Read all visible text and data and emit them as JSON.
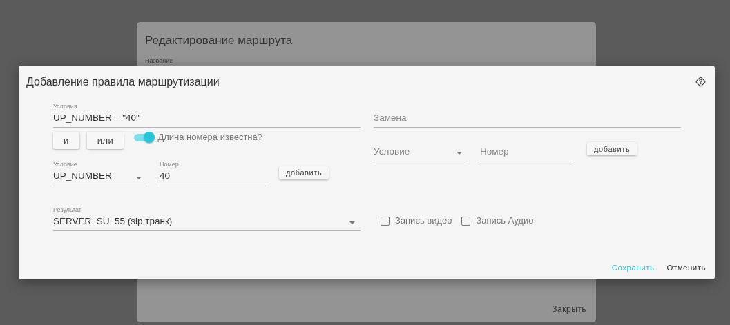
{
  "background_dialog": {
    "title": "Редактирование маршрута",
    "name_label": "Название",
    "close_button": "Закрыть"
  },
  "dialog": {
    "title": "Добавление правила маршрутизации",
    "conditions": {
      "label": "Условия",
      "value": "UP_NUMBER = \"40\""
    },
    "logic_buttons": [
      "и",
      "или"
    ],
    "length_known": {
      "label": "Длина номера известна?",
      "on": true
    },
    "condition_row": {
      "condition": {
        "label": "Условие",
        "value": "UP_NUMBER"
      },
      "number": {
        "label": "Номер",
        "value": "40"
      },
      "add_button": "добавить"
    },
    "replacement": {
      "placeholder": "Замена"
    },
    "replacement_row": {
      "condition": {
        "placeholder": "Условие"
      },
      "number": {
        "placeholder": "Номер"
      },
      "add_button": "добавить"
    },
    "result": {
      "label": "Результат",
      "value": "SERVER_SU_55 (sip транк)"
    },
    "checkboxes": [
      {
        "label": "Запись видео",
        "checked": false
      },
      {
        "label": "Запись Аудио",
        "checked": false
      }
    ],
    "buttons": [
      {
        "label": "Сохранить",
        "kind": "primary"
      },
      {
        "label": "Отменить",
        "kind": "secondary"
      }
    ]
  }
}
